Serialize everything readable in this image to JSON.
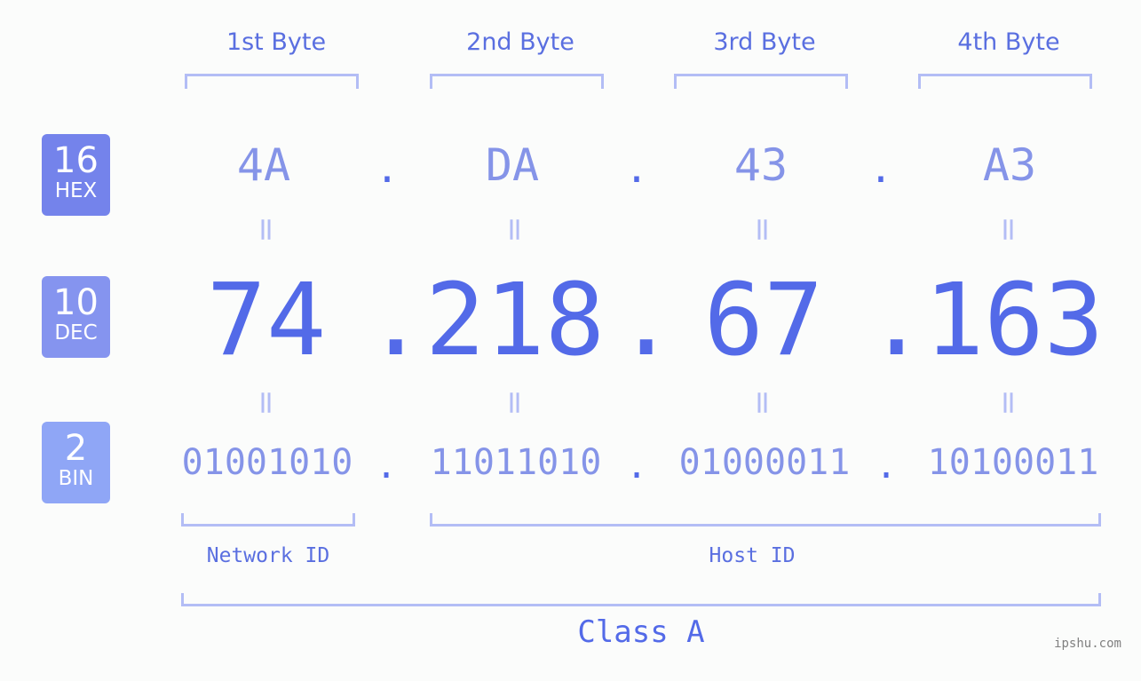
{
  "bytes": {
    "headers": [
      "1st Byte",
      "2nd Byte",
      "3rd Byte",
      "4th Byte"
    ]
  },
  "badges": {
    "hex": {
      "num": "16",
      "label": "HEX",
      "color": "#7483eb"
    },
    "dec": {
      "num": "10",
      "label": "DEC",
      "color": "#8594ef"
    },
    "bin": {
      "num": "2",
      "label": "BIN",
      "color": "#8fa6f6"
    }
  },
  "ip": {
    "hex": [
      "4A",
      "DA",
      "43",
      "A3"
    ],
    "dec": [
      "74",
      "218",
      "67",
      "163"
    ],
    "bin": [
      "01001010",
      "11011010",
      "01000011",
      "10100011"
    ],
    "separator": ".",
    "equals": "="
  },
  "segments": {
    "network": "Network ID",
    "host": "Host ID",
    "class": "Class A"
  },
  "watermark": "ipshu.com",
  "colors": {
    "accent": "#536ae8",
    "light_accent": "#8594e8",
    "bracket": "#b3bdf5"
  }
}
